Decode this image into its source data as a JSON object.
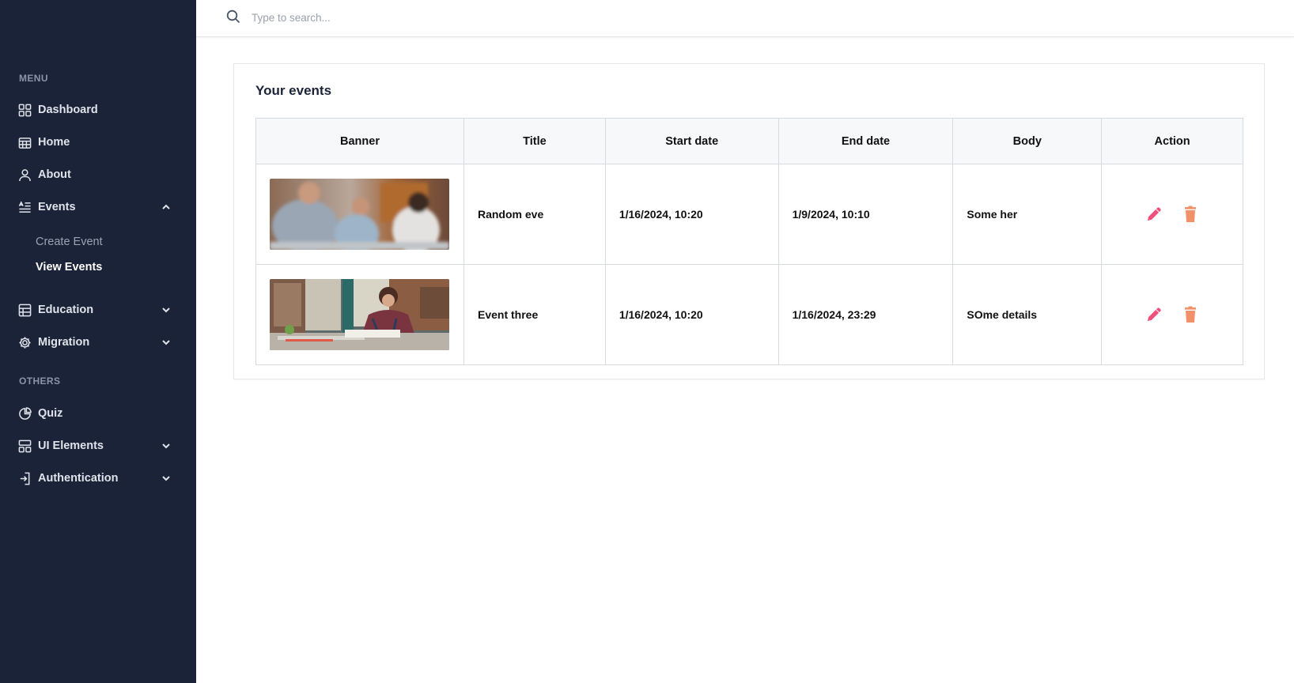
{
  "sidebar": {
    "menu_heading": "MENU",
    "others_heading": "OTHERS",
    "items": [
      {
        "label": "Dashboard",
        "icon": "grid-icon"
      },
      {
        "label": "Home",
        "icon": "calendar-icon"
      },
      {
        "label": "About",
        "icon": "user-icon"
      },
      {
        "label": "Events",
        "icon": "list-icon",
        "expanded": true
      },
      {
        "label": "Education",
        "icon": "table-icon"
      },
      {
        "label": "Migration",
        "icon": "gear-icon"
      },
      {
        "label": "Quiz",
        "icon": "pie-chart-icon"
      },
      {
        "label": "UI Elements",
        "icon": "layout-icon"
      },
      {
        "label": "Authentication",
        "icon": "login-icon"
      }
    ],
    "events_sub": [
      {
        "label": "Create Event"
      },
      {
        "label": "View Events",
        "active": true
      }
    ]
  },
  "search": {
    "placeholder": "Type to search...",
    "value": ""
  },
  "main": {
    "card_title": "Your events",
    "table": {
      "headers": [
        "Banner",
        "Title",
        "Start date",
        "End date",
        "Body",
        "Action"
      ],
      "rows": [
        {
          "banner": "photo of people talking at a cafe",
          "title": "Random eve",
          "start": "1/16/2024, 10:20",
          "end": "1/9/2024, 10:10",
          "body": "Some her"
        },
        {
          "banner": "photo of woman reading at a table",
          "title": "Event three",
          "start": "1/16/2024, 10:20",
          "end": "1/16/2024, 23:29",
          "body": "SOme details"
        }
      ]
    }
  },
  "colors": {
    "sidebar_bg": "#1b2338",
    "edit_icon": "#f0507a",
    "delete_icon": "#f2906a"
  }
}
